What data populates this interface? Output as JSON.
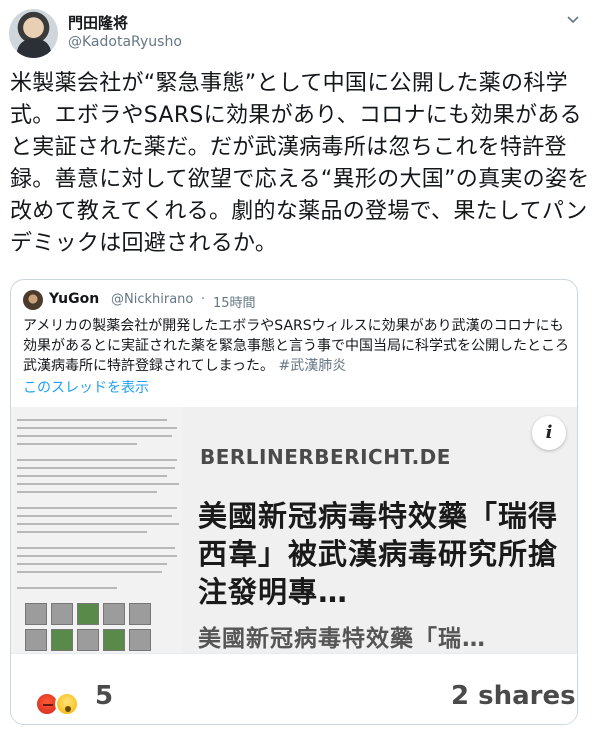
{
  "author": {
    "name": "門田隆将",
    "handle": "@KadotaRyusho"
  },
  "tweet": {
    "text": "米製薬会社が“緊急事態”として中国に公開した薬の科学式。エボラやSARSに効果があり、コロナにも効果があると実証された薬だ。だが武漢病毒所は忽ちこれを特許登録。善意に対して欲望で応える“異形の大国”の真実の姿を改めて教えてくれる。劇的な薬品の登場で、果たしてパンデミックは回避されるか。"
  },
  "quote": {
    "name": "YuGon",
    "handle": "@Nickhirano",
    "separator": "·",
    "time": "15時間",
    "text": "アメリカの製薬会社が開発したエボラやSARSウィルスに効果があり武漢のコロナにも効果があるとに実証された薬を緊急事態と言う事で中国当局に科学式を公開したところ武漢病毒所に特許登録されてしまった。",
    "hashtag": "#武漢肺炎",
    "show_thread": "このスレッドを表示"
  },
  "media": {
    "site": "BERLINERBERICHT.DE",
    "headline": "美國新冠病毒特效藥「瑞得西韋」被武漢病毒研究所搶注發明專…",
    "subline": "美國新冠病毒特效藥「瑞…",
    "info_label": "i",
    "reaction_count": "5",
    "shares": "2 shares"
  },
  "icons": {
    "caret": "chevron-down-icon",
    "info": "info-icon",
    "reactions": [
      "angry-emoji-icon",
      "wow-emoji-icon"
    ]
  },
  "colors": {
    "link": "#1da1f2",
    "secondary_text": "#657786",
    "border": "#ccd6dd"
  }
}
